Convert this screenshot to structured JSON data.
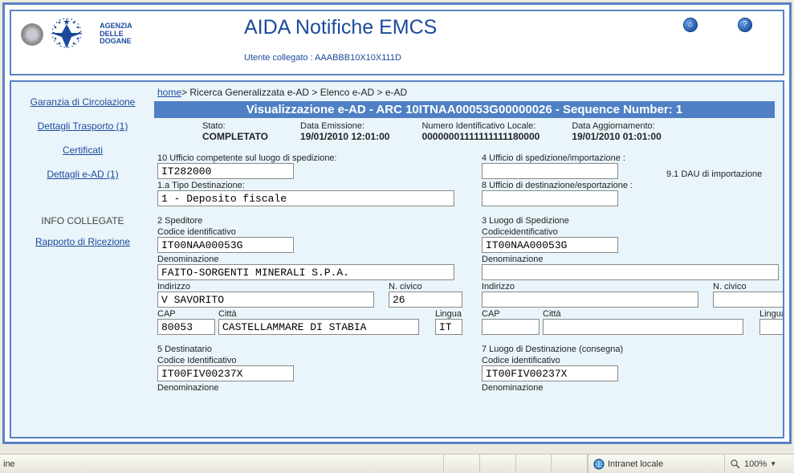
{
  "header": {
    "agency_l1": "AGENZIA",
    "agency_l2": "DELLE",
    "agency_l3": "DOGANE",
    "title": "AIDA Notifiche EMCS",
    "user_label": "Utente collegato : AAABBB10X10X111D"
  },
  "sidebar": {
    "link1": "Garanzia di Circolazione",
    "link2": "Dettagli Trasporto (1)",
    "link3": "Certificati",
    "link4": "Dettagli e-AD (1)",
    "section": "INFO COLLEGATE",
    "link5": "Rapporto di Ricezione"
  },
  "breadcrumb": {
    "home": "home",
    "rest": "> Ricerca Generalizzata e-AD > Elenco e-AD > e-AD"
  },
  "bluebar": "Visualizzazione e-AD - ARC 10ITNAA00053G00000026 - Sequence Number: 1",
  "summary": {
    "stato_l": "Stato:",
    "stato_v": "COMPLETATO",
    "emiss_l": "Data Emissione:",
    "emiss_v": "19/01/2010 12:01:00",
    "numid_l": "Numero Identificativo Locale:",
    "numid_v": "00000001111111111180000",
    "agg_l": "Data Aggiornamento:",
    "agg_v": "19/01/2010 01:01:00"
  },
  "left": {
    "f10_l": "10 Ufficio competente sul luogo di spedizione:",
    "f10_v": "IT282000",
    "f1a_l": "1.a Tipo Destinazione:",
    "f1a_v": "1 - Deposito fiscale",
    "s2_head": "2 Speditore",
    "codid_l": "Codice identificativo",
    "codid_v": "IT00NAA00053G",
    "denom_l": "Denominazione",
    "denom_v": "FAITO-SORGENTI MINERALI S.P.A.",
    "ind_l": "Indirizzo",
    "ind_v": "V SAVORITO",
    "nciv_l": "N. civico",
    "nciv_v": "26",
    "cap_l": "CAP",
    "cap_v": "80053",
    "citta_l": "Città",
    "citta_v": "CASTELLAMMARE DI STABIA",
    "ling_l": "Lingua",
    "ling_v": "IT",
    "s5_head": "5 Destinatario",
    "s5_cod_l": "Codice Identificativo",
    "s5_cod_v": "IT00FIV00237X",
    "s5_den_l": "Denominazione"
  },
  "right": {
    "f4_l": "4 Ufficio di spedizione/importazione :",
    "f91_l": "9.1 DAU di importazione",
    "f8_l": "8 Ufficio di destinazione/esportazione :",
    "s3_head": "3 Luogo di Spedizione",
    "codid_l": "Codiceidentificativo",
    "codid_v": "IT00NAA00053G",
    "denom_l": "Denominazione",
    "ind_l": "Indirizzo",
    "nciv_l": "N. civico",
    "cap_l": "CAP",
    "citta_l": "Città",
    "ling_l": "Lingua",
    "s7_head": "7 Luogo di Destinazione (consegna)",
    "s7_cod_l": "Codice identificativo",
    "s7_cod_v": "IT00FIV00237X",
    "s7_den_l": "Denominazione"
  },
  "status": {
    "left": "ine",
    "zone": "Intranet locale",
    "zoom": "100%"
  }
}
